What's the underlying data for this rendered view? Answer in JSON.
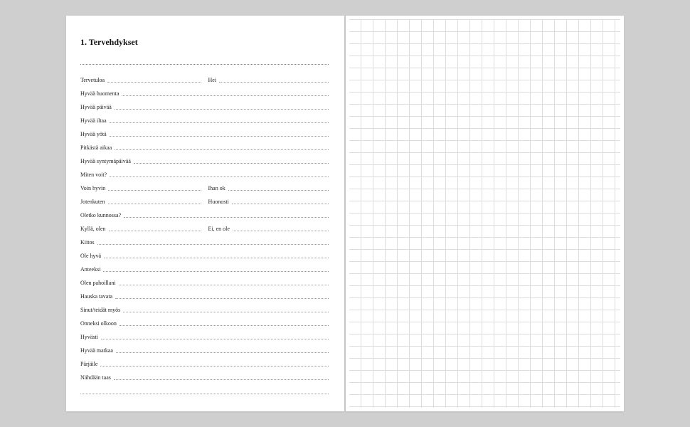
{
  "section": {
    "number": "1.",
    "title": "Tervehdykset"
  },
  "rows": [
    {
      "type": "pair",
      "a": "Tervetuloa",
      "b": "Hei"
    },
    {
      "type": "single",
      "a": "Hyvää huomenta"
    },
    {
      "type": "single",
      "a": "Hyvää päivää"
    },
    {
      "type": "single",
      "a": "Hyvää iltaa"
    },
    {
      "type": "single",
      "a": "Hyvää yötä"
    },
    {
      "type": "single",
      "a": "Pitkästä aikaa"
    },
    {
      "type": "single",
      "a": "Hyvää syntymäpäivää"
    },
    {
      "type": "single",
      "a": "Miten voit?"
    },
    {
      "type": "pair",
      "a": "Voin hyvin",
      "b": "Ihan ok"
    },
    {
      "type": "pair",
      "a": "Jotenkuten",
      "b": "Huonosti"
    },
    {
      "type": "single",
      "a": "Oletko kunnossa?"
    },
    {
      "type": "pair",
      "a": "Kyllä, olen",
      "b": "Ei, en ole"
    },
    {
      "type": "single",
      "a": "Kiitos"
    },
    {
      "type": "single",
      "a": "Ole hyvä"
    },
    {
      "type": "single",
      "a": "Anteeksi"
    },
    {
      "type": "single",
      "a": "Olen pahoillani"
    },
    {
      "type": "single",
      "a": "Hauska tavata"
    },
    {
      "type": "single",
      "a": "Sinut/teidät myös"
    },
    {
      "type": "single",
      "a": "Onneksi olkoon"
    },
    {
      "type": "single",
      "a": "Hyvästi"
    },
    {
      "type": "single",
      "a": "Hyvää matkaa"
    },
    {
      "type": "single",
      "a": "Pärjäile"
    },
    {
      "type": "single",
      "a": "Nähdään taas"
    }
  ]
}
